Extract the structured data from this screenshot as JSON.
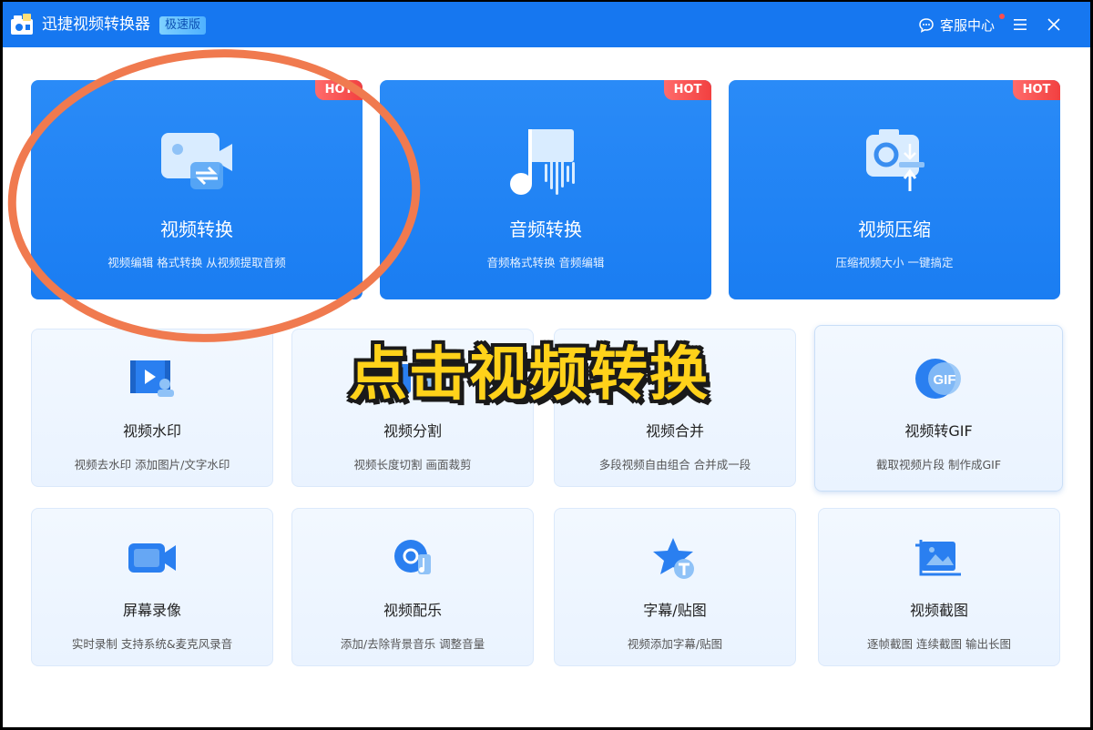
{
  "titlebar": {
    "app_title": "迅捷视频转换器",
    "edition": "极速版",
    "support_label": "客服中心",
    "menu_icon": "menu-icon",
    "close_icon": "close-icon"
  },
  "big_cards": [
    {
      "title": "视频转换",
      "desc": "视频编辑 格式转换 从视频提取音频",
      "badge": "HOT",
      "icon": "video-convert-icon"
    },
    {
      "title": "音频转换",
      "desc": "音频格式转换 音频编辑",
      "badge": "HOT",
      "icon": "audio-convert-icon"
    },
    {
      "title": "视频压缩",
      "desc": "压缩视频大小 一键搞定",
      "badge": "HOT",
      "icon": "video-compress-icon"
    }
  ],
  "small_cards": [
    {
      "title": "视频水印",
      "desc": "视频去水印 添加图片/文字水印",
      "icon": "video-watermark-icon"
    },
    {
      "title": "视频分割",
      "desc": "视频长度切割 画面裁剪",
      "icon": "video-split-icon"
    },
    {
      "title": "视频合并",
      "desc": "多段视频自由组合 合并成一段",
      "icon": "video-merge-icon"
    },
    {
      "title": "视频转GIF",
      "desc": "截取视频片段 制作成GIF",
      "icon": "gif-icon",
      "icon_text": "GIF"
    },
    {
      "title": "屏幕录像",
      "desc": "实时录制 支持系统&麦克风录音",
      "icon": "screen-record-icon"
    },
    {
      "title": "视频配乐",
      "desc": "添加/去除背景音乐 调整音量",
      "icon": "video-music-icon"
    },
    {
      "title": "字幕/贴图",
      "desc": "视频添加字幕/贴图",
      "icon": "subtitle-sticker-icon"
    },
    {
      "title": "视频截图",
      "desc": "逐帧截图 连续截图 输出长图",
      "icon": "video-screenshot-icon"
    }
  ],
  "overlay": {
    "caption": "点击视频转换"
  },
  "colors": {
    "titlebar": "#1677f0",
    "card_blue": "#1a7df2",
    "hot_red": "#f24040",
    "annotation_circle": "#f07a4f",
    "caption_yellow": "#ffd21a"
  }
}
